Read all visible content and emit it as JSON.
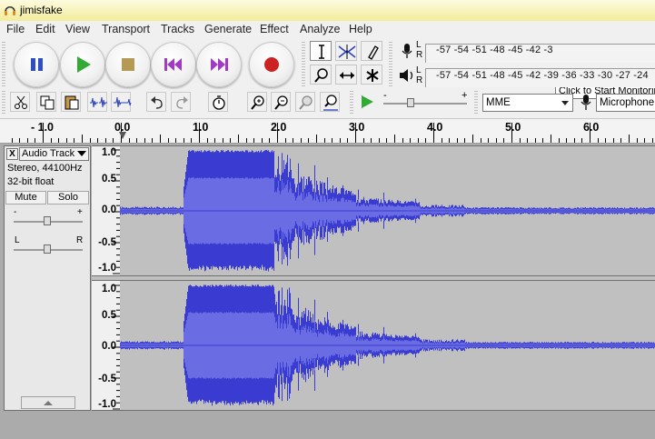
{
  "window": {
    "title": "jimisfake"
  },
  "menu": [
    "File",
    "Edit",
    "View",
    "Transport",
    "Tracks",
    "Generate",
    "Effect",
    "Analyze",
    "Help"
  ],
  "meters": {
    "record_ticks": "-57 -54 -51 -48 -45 -42 -3",
    "play_ticks": "-57 -54 -51 -48 -45 -42 -39 -36 -33 -30 -27 -24",
    "record_channels": "L\nR",
    "play_channels": "L\nR",
    "monitor_tooltip": "Click to Start Monitorin"
  },
  "devices": {
    "host": "MME",
    "input": "Microphone ("
  },
  "play_speed_minus": "-",
  "play_speed_plus": "+",
  "ruler": {
    "labels": [
      "- 1.0",
      "0.0",
      "1.0",
      "2.0",
      "3.0",
      "4.0",
      "5.0",
      "6.0"
    ]
  },
  "track": {
    "close": "X",
    "name": "Audio Track",
    "format_line1": "Stereo, 44100Hz",
    "format_line2": "32-bit float",
    "mute": "Mute",
    "solo": "Solo",
    "gain_minus": "-",
    "gain_plus": "+",
    "pan_left": "L",
    "pan_right": "R"
  },
  "vertical_scale": [
    "1.0",
    "0.5",
    "0.0",
    "-0.5",
    "-1.0"
  ],
  "colors": {
    "waveform": "#3a3bd0",
    "waveform_rms": "#6a6ce4",
    "track_bg": "#c0c0c0",
    "record": "#cc2222",
    "play": "#33aa33"
  }
}
